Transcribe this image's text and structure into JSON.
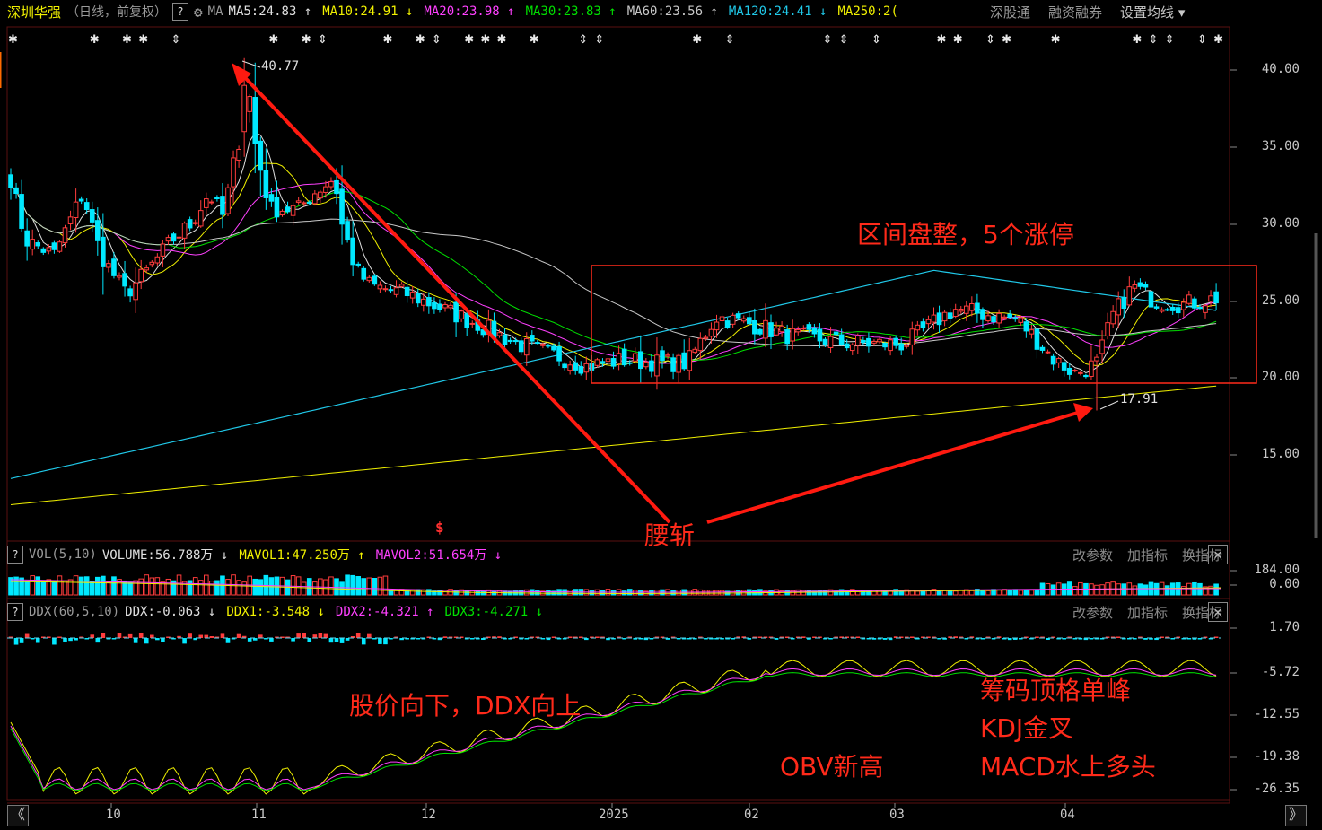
{
  "header": {
    "stock_name": "深圳华强",
    "mode": "（日线，前复权）",
    "help_label": "?",
    "indicator": "MA",
    "ma_items": [
      {
        "label": "MA5:24.83",
        "arrow": "↑",
        "color": "#e0e0e0"
      },
      {
        "label": "MA10:24.91",
        "arrow": "↓",
        "color": "#f0f000"
      },
      {
        "label": "MA20:23.98",
        "arrow": "↑",
        "color": "#ff40ff"
      },
      {
        "label": "MA30:23.83",
        "arrow": "↑",
        "color": "#00e000"
      },
      {
        "label": "MA60:23.56",
        "arrow": "↑",
        "color": "#c8c8c8"
      },
      {
        "label": "MA120:24.41",
        "arrow": "↓",
        "color": "#20c8e8"
      },
      {
        "label": "MA250:2(",
        "arrow": "",
        "color": "#f0f000"
      }
    ],
    "right_links": [
      "深股通",
      "融资融券",
      "设置均线"
    ],
    "dropdown_arrow": "▾"
  },
  "vol_panel": {
    "name": "VOL(5,10)",
    "items": [
      {
        "label": "VOLUME:56.788万",
        "arrow": "↓",
        "color": "#e0e0e0"
      },
      {
        "label": "MAVOL1:47.250万",
        "arrow": "↑",
        "color": "#f0f000"
      },
      {
        "label": "MAVOL2:51.654万",
        "arrow": "↓",
        "color": "#ff40ff"
      }
    ],
    "tools": [
      "改参数",
      "加指标",
      "换指标"
    ],
    "close": "✕"
  },
  "ddx_panel": {
    "name": "DDX(60,5,10)",
    "items": [
      {
        "label": "DDX:-0.063",
        "arrow": "↓",
        "color": "#e0e0e0"
      },
      {
        "label": "DDX1:-3.548",
        "arrow": "↓",
        "color": "#f0f000"
      },
      {
        "label": "DDX2:-4.321",
        "arrow": "↑",
        "color": "#ff40ff"
      },
      {
        "label": "DDX3:-4.271",
        "arrow": "↓",
        "color": "#00e000"
      }
    ],
    "tools": [
      "改参数",
      "加指标",
      "换指标"
    ],
    "close": "✕"
  },
  "price_axis": [
    "40.00",
    "35.00",
    "30.00",
    "25.00",
    "20.00",
    "15.00"
  ],
  "vol_axis": [
    "184.00",
    "0.00"
  ],
  "ddx_axis": [
    "1.70",
    "-5.72",
    "-12.55",
    "-19.38",
    "-26.35"
  ],
  "x_axis": [
    "10",
    "11",
    "12",
    "2025",
    "02",
    "03",
    "04"
  ],
  "price_labels": {
    "high": "40.77",
    "low": "17.91"
  },
  "annotations": {
    "range": "区间盘整，5个涨停",
    "waist": "腰斩",
    "price_ddx": "股价向下，DDX向上",
    "chips": "筹码顶格单峰",
    "kdj": "KDJ金叉",
    "macd": "MACD水上多头",
    "obv": "OBV新高"
  },
  "markers": {
    "event": "$"
  },
  "nav": {
    "left": "《",
    "right": "》"
  },
  "colors": {
    "up": "#ff3c3c",
    "down": "#00e8ff",
    "annotation": "#ff2a1a",
    "grid": "#5a1010"
  },
  "chart_data": {
    "type": "candlestick",
    "period": "daily",
    "ylim": [
      11,
      42
    ],
    "key_prices": {
      "high": 40.77,
      "low": 17.91
    },
    "ma_latest": {
      "MA5": 24.83,
      "MA10": 24.91,
      "MA20": 23.98,
      "MA30": 23.83,
      "MA60": 23.56,
      "MA120": 24.41
    },
    "volume_latest": {
      "VOLUME": "56.788万",
      "MAVOL1": "47.250万",
      "MAVOL2": "51.654万"
    },
    "ddx_latest": {
      "DDX": -0.063,
      "DDX1": -3.548,
      "DDX2": -4.321,
      "DDX3": -4.271
    }
  }
}
